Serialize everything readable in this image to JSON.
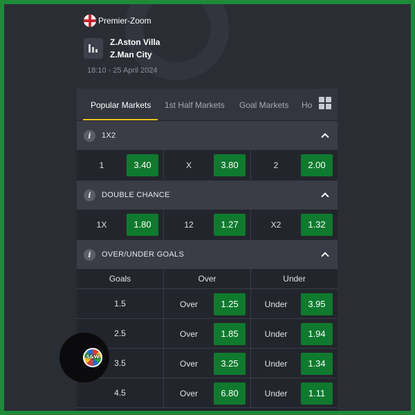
{
  "match": {
    "league": "Premier-Zoom",
    "home_team": "Z.Aston Villa",
    "away_team": "Z.Man City",
    "datetime": "18:10 - 25 April 2024"
  },
  "tabs": [
    {
      "label": "Popular Markets",
      "active": true
    },
    {
      "label": "1st Half Markets",
      "active": false
    },
    {
      "label": "Goal Markets",
      "active": false
    },
    {
      "label": "Ho",
      "active": false
    }
  ],
  "markets": {
    "x12": {
      "title": "1X2",
      "options": [
        {
          "label": "1",
          "odds": "3.40"
        },
        {
          "label": "X",
          "odds": "3.80"
        },
        {
          "label": "2",
          "odds": "2.00"
        }
      ]
    },
    "double_chance": {
      "title": "DOUBLE CHANCE",
      "options": [
        {
          "label": "1X",
          "odds": "1.80"
        },
        {
          "label": "12",
          "odds": "1.27"
        },
        {
          "label": "X2",
          "odds": "1.32"
        }
      ]
    },
    "over_under": {
      "title": "OVER/UNDER GOALS",
      "columns": [
        "Goals",
        "Over",
        "Under"
      ],
      "over_label": "Over",
      "under_label": "Under",
      "rows": [
        {
          "goals": "1.5",
          "over": "1.25",
          "under": "3.95"
        },
        {
          "goals": "2.5",
          "over": "1.85",
          "under": "1.94"
        },
        {
          "goals": "3.5",
          "over": "3.25",
          "under": "1.34"
        },
        {
          "goals": "4.5",
          "over": "6.80",
          "under": "1.11"
        }
      ]
    }
  },
  "badge": {
    "text": "S&W"
  },
  "colors": {
    "odds_button": "#0f7a2e",
    "active_tab_underline": "#f4c21d",
    "outer_border": "#1f8a3a"
  },
  "icons": [
    "flag-england-icon",
    "stats-icon",
    "grid-menu-icon",
    "info-icon",
    "chevron-up-icon"
  ]
}
